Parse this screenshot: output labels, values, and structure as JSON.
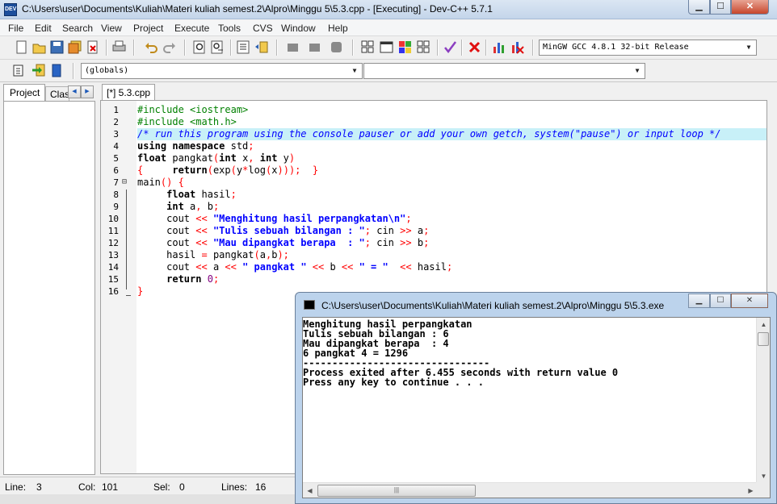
{
  "window": {
    "title": "C:\\Users\\user\\Documents\\Kuliah\\Materi kuliah semest.2\\Alpro\\Minggu 5\\5.3.cpp - [Executing] - Dev-C++ 5.7.1",
    "app_icon_text": "DEV"
  },
  "menu": [
    "File",
    "Edit",
    "Search",
    "View",
    "Project",
    "Execute",
    "Tools",
    "CVS",
    "Window",
    "Help"
  ],
  "toolbar": {
    "compiler_select": "MinGW GCC 4.8.1 32-bit Release",
    "scope_select": "(globals)",
    "function_select": ""
  },
  "left_panel": {
    "tabs": [
      "Project",
      "Classes"
    ]
  },
  "editor": {
    "tab_label": "[*] 5.3.cpp",
    "line_numbers": [
      "1",
      "2",
      "3",
      "4",
      "5",
      "6",
      "7",
      "8",
      "9",
      "10",
      "11",
      "12",
      "13",
      "14",
      "15",
      "16"
    ],
    "highlight_line": 3,
    "lines": [
      [
        [
          "pp",
          "#include <iostream>"
        ]
      ],
      [
        [
          "pp",
          "#include <math.h>"
        ]
      ],
      [
        [
          "cm",
          "/* run this program using the console pauser or add your own getch, system(\"pause\") or input loop */"
        ]
      ],
      [
        [
          "k",
          "using namespace"
        ],
        [
          "id",
          " std"
        ],
        [
          "sym",
          ";"
        ]
      ],
      [
        [
          "k",
          "float"
        ],
        [
          "id",
          " pangkat"
        ],
        [
          "sym",
          "("
        ],
        [
          "k",
          "int"
        ],
        [
          "id",
          " x"
        ],
        [
          "sym",
          ", "
        ],
        [
          "k",
          "int"
        ],
        [
          "id",
          " y"
        ],
        [
          "sym",
          ")"
        ]
      ],
      [
        [
          "sym",
          "{     "
        ],
        [
          "k",
          "return"
        ],
        [
          "sym",
          "("
        ],
        [
          "id",
          "exp"
        ],
        [
          "sym",
          "("
        ],
        [
          "id",
          "y"
        ],
        [
          "sym",
          "*"
        ],
        [
          "id",
          "log"
        ],
        [
          "sym",
          "("
        ],
        [
          "id",
          "x"
        ],
        [
          "sym",
          ")));  }"
        ]
      ],
      [
        [
          "id",
          "main"
        ],
        [
          "sym",
          "() {"
        ]
      ],
      [
        [
          "id",
          "     "
        ],
        [
          "k",
          "float"
        ],
        [
          "id",
          " hasil"
        ],
        [
          "sym",
          ";"
        ]
      ],
      [
        [
          "id",
          "     "
        ],
        [
          "k",
          "int"
        ],
        [
          "id",
          " a"
        ],
        [
          "sym",
          ", "
        ],
        [
          "id",
          "b"
        ],
        [
          "sym",
          ";"
        ]
      ],
      [
        [
          "id",
          "     cout "
        ],
        [
          "sym",
          "<< "
        ],
        [
          "str",
          "\"Menghitung hasil perpangkatan\\n\""
        ],
        [
          "sym",
          ";"
        ]
      ],
      [
        [
          "id",
          "     cout "
        ],
        [
          "sym",
          "<< "
        ],
        [
          "str",
          "\"Tulis sebuah bilangan : \""
        ],
        [
          "sym",
          "; "
        ],
        [
          "id",
          "cin "
        ],
        [
          "sym",
          ">> "
        ],
        [
          "id",
          "a"
        ],
        [
          "sym",
          ";"
        ]
      ],
      [
        [
          "id",
          "     cout "
        ],
        [
          "sym",
          "<< "
        ],
        [
          "str",
          "\"Mau dipangkat berapa  : \""
        ],
        [
          "sym",
          "; "
        ],
        [
          "id",
          "cin "
        ],
        [
          "sym",
          ">> "
        ],
        [
          "id",
          "b"
        ],
        [
          "sym",
          ";"
        ]
      ],
      [
        [
          "id",
          "     hasil "
        ],
        [
          "sym",
          "= "
        ],
        [
          "id",
          "pangkat"
        ],
        [
          "sym",
          "("
        ],
        [
          "id",
          "a"
        ],
        [
          "sym",
          ","
        ],
        [
          "id",
          "b"
        ],
        [
          "sym",
          ");"
        ]
      ],
      [
        [
          "id",
          "     cout "
        ],
        [
          "sym",
          "<< "
        ],
        [
          "id",
          "a "
        ],
        [
          "sym",
          "<< "
        ],
        [
          "str",
          "\" pangkat \""
        ],
        [
          "sym",
          " << "
        ],
        [
          "id",
          "b "
        ],
        [
          "sym",
          "<< "
        ],
        [
          "str",
          "\" = \""
        ],
        [
          "sym",
          "  << "
        ],
        [
          "id",
          "hasil"
        ],
        [
          "sym",
          ";"
        ]
      ],
      [
        [
          "id",
          "     "
        ],
        [
          "k",
          "return"
        ],
        [
          "num",
          " 0"
        ],
        [
          "sym",
          ";"
        ]
      ],
      [
        [
          "sym",
          "}"
        ]
      ]
    ]
  },
  "status": {
    "line_label": "Line:",
    "line_value": "3",
    "col_label": "Col:",
    "col_value": "101",
    "sel_label": "Sel:",
    "sel_value": "0",
    "lines_label": "Lines:",
    "lines_value": "16"
  },
  "console": {
    "title": "C:\\Users\\user\\Documents\\Kuliah\\Materi kuliah semest.2\\Alpro\\Minggu 5\\5.3.exe",
    "output": [
      "Menghitung hasil perpangkatan",
      "Tulis sebuah bilangan : 6",
      "Mau dipangkat berapa  : 4",
      "6 pangkat 4 = 1296",
      "--------------------------------",
      "Process exited after 6.455 seconds with return value 0",
      "Press any key to continue . . ."
    ]
  },
  "colors": {
    "comment_highlight": "#c8f0f8",
    "keyword_symbol": "#ff0000",
    "string": "#0000ff",
    "preprocessor": "#008000",
    "number": "#800080"
  }
}
